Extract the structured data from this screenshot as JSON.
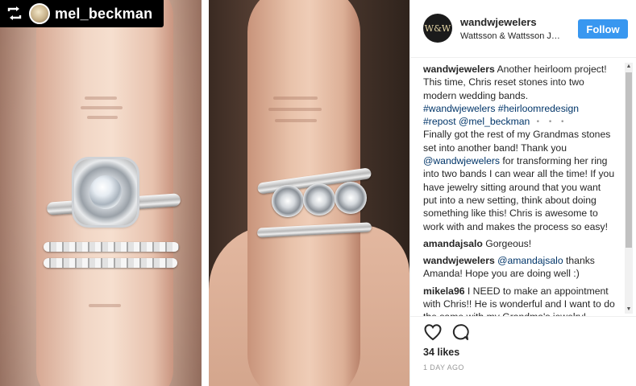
{
  "repost_badge": {
    "username": "mel_beckman",
    "icon": "repost-icon"
  },
  "header": {
    "avatar_text": "W&W",
    "username": "wandwjewelers",
    "subtitle": "Wattsson & Wattsson Jewe...",
    "follow_label": "Follow"
  },
  "caption": {
    "username": "wandwjewelers",
    "text": "Another heirloom project! This time, Chris reset stones into two modern wedding bands.",
    "hashtags": "#wandwjewelers #heirloomredesign",
    "repost_mention": "#repost @mel_beckman",
    "more": "・・・",
    "body": "Finally got the rest of my Grandmas stones set into another band! Thank you ",
    "body_mention": "@wandwjewelers",
    "body_rest": " for transforming her ring into two bands I can wear all the time! If you have jewelry sitting around that you want put into a new setting, think about doing something like this! Chris is awesome to work with and makes the process so easy!"
  },
  "comments": [
    {
      "username": "amandajsalo",
      "text": "Gorgeous!"
    },
    {
      "username": "wandwjewelers",
      "mention": "@amandajsalo",
      "text": " thanks Amanda! Hope you are doing well :)"
    },
    {
      "username": "mikela96",
      "text": "I NEED to make an appointment with Chris!! He is wonderful and I want to do the same with my Grandma's jewelry!"
    }
  ],
  "footer": {
    "likes": "34 likes",
    "age": "1 DAY AGO",
    "like_icon": "heart-icon",
    "comment_icon": "comment-icon"
  },
  "colors": {
    "follow_blue": "#3897f0",
    "link_navy": "#003569",
    "muted_gray": "#999999"
  }
}
